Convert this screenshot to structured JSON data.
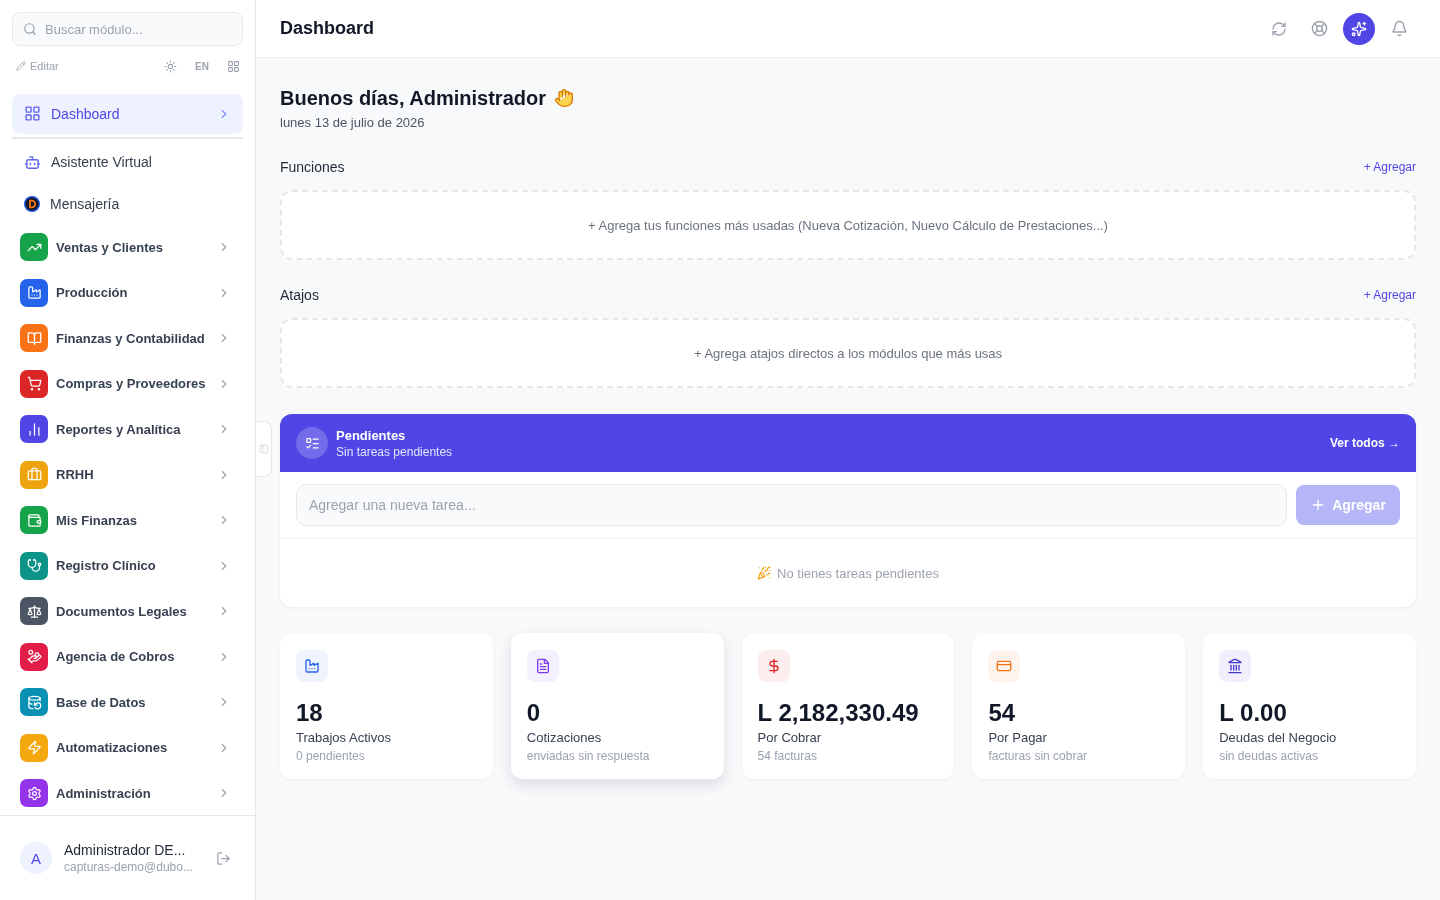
{
  "sidebar": {
    "search": {
      "placeholder": "Buscar módulo..."
    },
    "edit_label": "Editar",
    "language": "EN",
    "pinned": [
      {
        "label": "Dashboard",
        "kind": "page",
        "selected": true
      }
    ],
    "items": [
      {
        "label": "Asistente Virtual",
        "kind": "link",
        "selected": false
      },
      {
        "label": "Mensajería",
        "kind": "link",
        "selected": false
      },
      {
        "label": "Ventas y Clientes",
        "kind": "module",
        "selected": false,
        "color": "#16a34a"
      },
      {
        "label": "Producción",
        "kind": "module",
        "selected": false,
        "color": "#2563eb"
      },
      {
        "label": "Finanzas y Contabilidad",
        "kind": "module",
        "selected": false,
        "color": "#f97316"
      },
      {
        "label": "Compras y Proveedores",
        "kind": "module",
        "selected": false,
        "color": "#dc2626"
      },
      {
        "label": "Reportes y Analítica",
        "kind": "module",
        "selected": false,
        "color": "#4f46e5"
      },
      {
        "label": "RRHH",
        "kind": "module",
        "selected": false,
        "color": "#eda40e"
      },
      {
        "label": "Mis Finanzas",
        "kind": "module",
        "selected": false,
        "color": "#16a34a"
      },
      {
        "label": "Registro Clínico",
        "kind": "module",
        "selected": false,
        "color": "#0d9488"
      },
      {
        "label": "Documentos Legales",
        "kind": "module",
        "selected": false,
        "color": "#4b5563"
      },
      {
        "label": "Agencia de Cobros",
        "kind": "module",
        "selected": false,
        "color": "#e11d48"
      },
      {
        "label": "Base de Datos",
        "kind": "module",
        "selected": false,
        "color": "#0891b2"
      },
      {
        "label": "Automatizaciones",
        "kind": "module",
        "selected": false,
        "color": "#f5a70f"
      },
      {
        "label": "Administración",
        "kind": "module",
        "selected": false,
        "color": "#9333ea"
      }
    ],
    "user": {
      "initial": "A",
      "name": "Administrador DE...",
      "email": "capturas-demo@dubo..."
    }
  },
  "header": {
    "title": "Dashboard"
  },
  "greeting": {
    "title": "Buenos días, Administrador",
    "date": "lunes 13 de julio de 2026"
  },
  "sections": [
    {
      "title": "Funciones",
      "action": "+ Agregar",
      "empty_text": "+ Agrega tus funciones más usadas (Nueva Cotización, Nuevo Cálculo de Prestaciones...)"
    },
    {
      "title": "Atajos",
      "action": "+ Agregar",
      "empty_text": "+ Agrega atajos directos a los módulos que más usas"
    }
  ],
  "tasks": {
    "title": "Pendientes",
    "subtitle": "Sin tareas pendientes",
    "view_all": "Ver todos →",
    "input": {
      "placeholder": "Agregar una nueva tarea..."
    },
    "add_button": {
      "label": "Agregar",
      "disabled": true
    },
    "empty_text": "No tienes tareas pendientes"
  },
  "stats": [
    {
      "value": "18",
      "label": "Trabajos Activos",
      "detail": "0 pendientes",
      "color": "#2563eb",
      "hovered": false
    },
    {
      "value": "0",
      "label": "Cotizaciones",
      "detail": "enviadas sin respuesta",
      "color": "#7c3aed",
      "hovered": true
    },
    {
      "value": "L 2,182,330.49",
      "label": "Por Cobrar",
      "detail": "54 facturas",
      "color": "#dc2626",
      "hovered": false
    },
    {
      "value": "54",
      "label": "Por Pagar",
      "detail": "facturas sin cobrar",
      "color": "#f97316",
      "hovered": false
    },
    {
      "value": "L 0.00",
      "label": "Deudas del Negocio",
      "detail": "sin deudas activas",
      "color": "#4338ca",
      "hovered": false
    }
  ]
}
